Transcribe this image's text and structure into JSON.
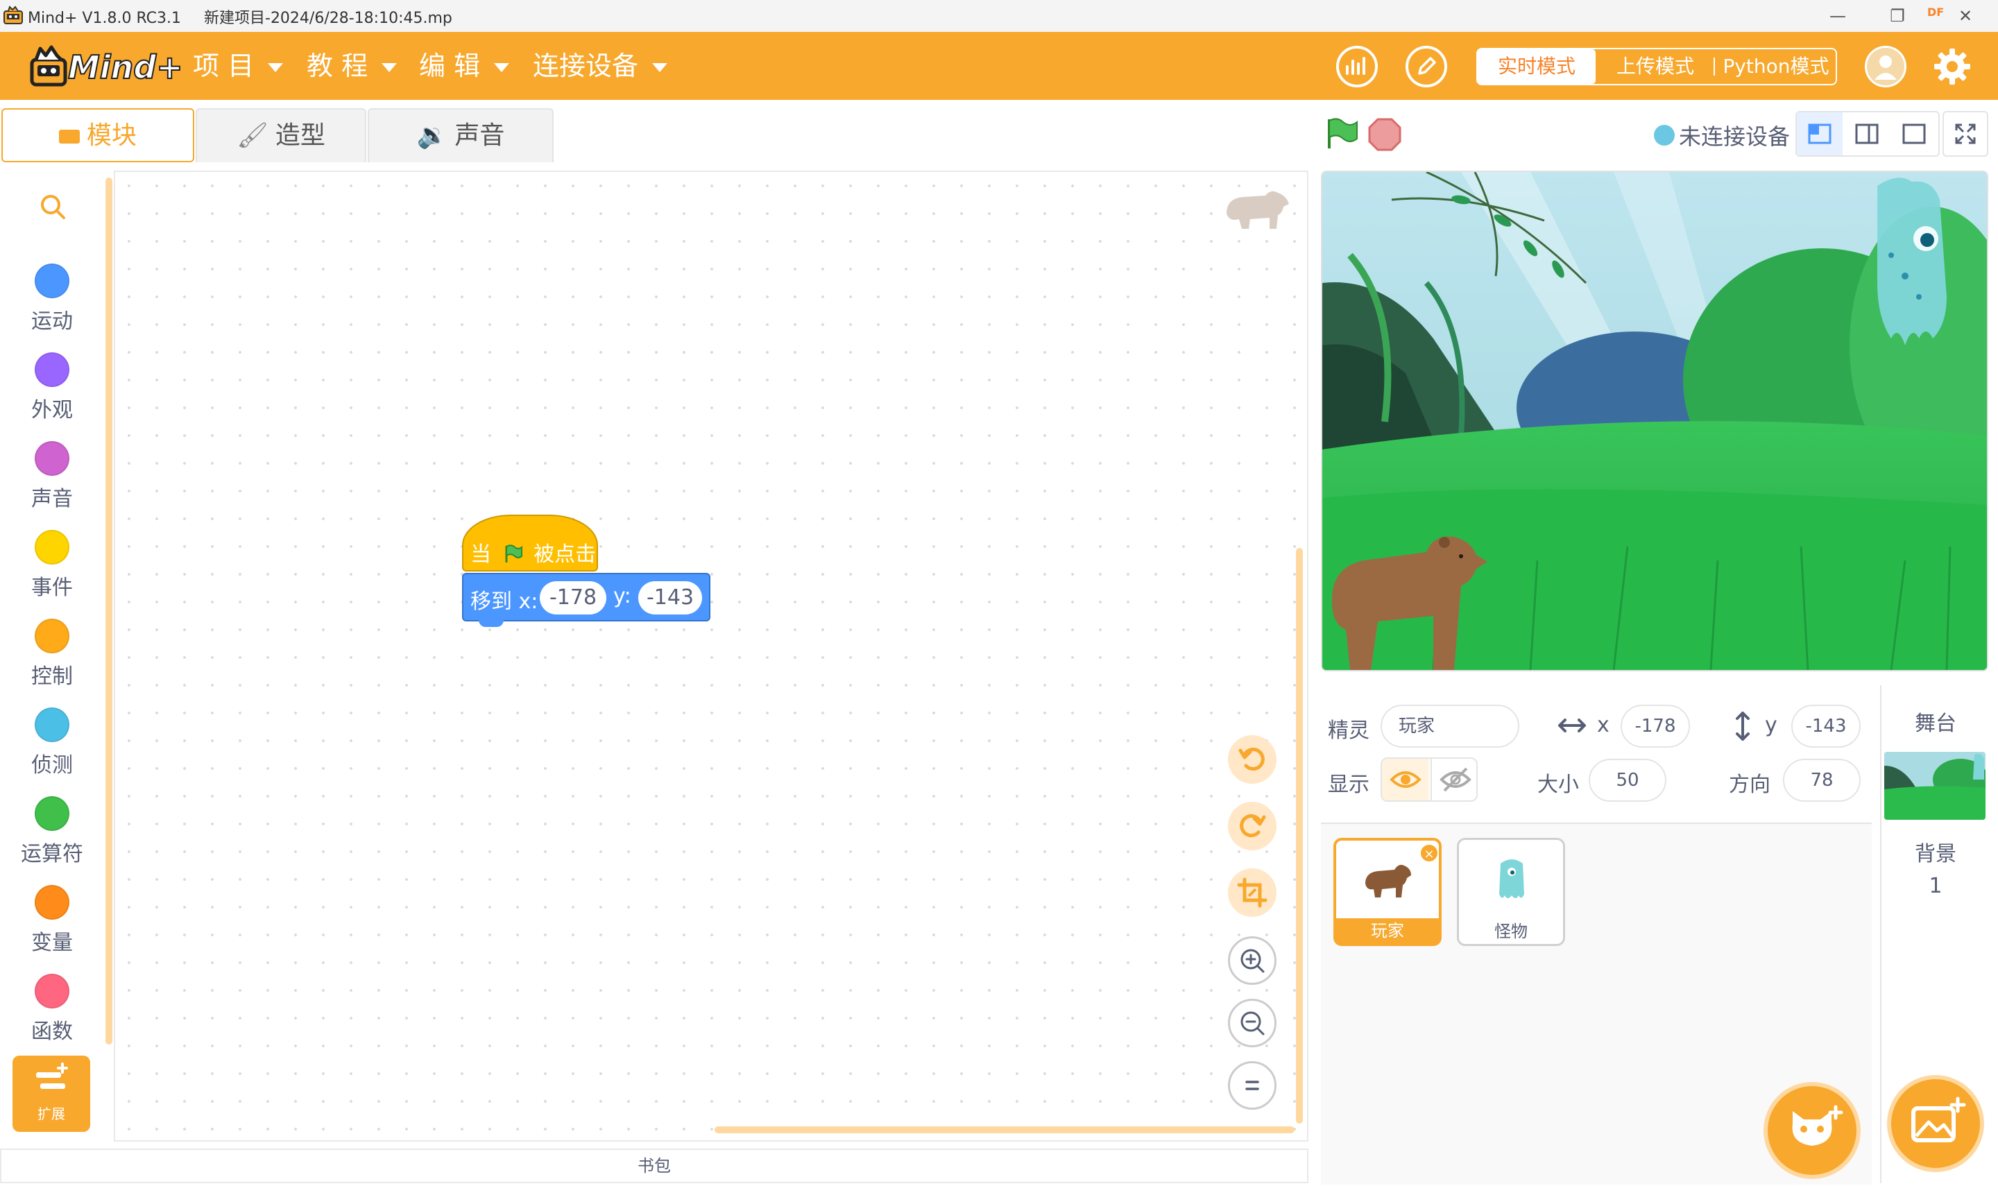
{
  "window": {
    "app_title": "Mind+ V1.8.0 RC3.1",
    "file_title": "新建项目-2024/6/28-18:10:45.mp",
    "df_badge": "DF",
    "icons": [
      "minimize-icon",
      "restore-icon",
      "close-icon"
    ]
  },
  "menubar": {
    "logo_text": "Mind+",
    "menus": [
      "项 目",
      "教 程",
      "编 辑",
      "连接设备"
    ],
    "modes": [
      "实时模式",
      "上传模式",
      "Python模式"
    ],
    "active_mode": "实时模式"
  },
  "tabs": [
    {
      "label": "模块",
      "icon": "blocks-icon",
      "active": true
    },
    {
      "label": "造型",
      "icon": "brush-icon",
      "active": false
    },
    {
      "label": "声音",
      "icon": "speaker-icon",
      "active": false
    }
  ],
  "categories": [
    {
      "label": "运动",
      "color": "#4c97ff"
    },
    {
      "label": "外观",
      "color": "#9966ff"
    },
    {
      "label": "声音",
      "color": "#cf63cf"
    },
    {
      "label": "事件",
      "color": "#ffd500"
    },
    {
      "label": "控制",
      "color": "#ffab19"
    },
    {
      "label": "侦测",
      "color": "#4cbfe6"
    },
    {
      "label": "运算符",
      "color": "#40bf4a"
    },
    {
      "label": "变量",
      "color": "#ff8c1a"
    },
    {
      "label": "函数",
      "color": "#ff6680"
    }
  ],
  "extension": {
    "label": "扩展"
  },
  "script": {
    "hat": {
      "prefix": "当",
      "suffix": "被点击"
    },
    "motion": {
      "label": "移到 x:",
      "x": "-178",
      "y_label": "y:",
      "y": "-143"
    }
  },
  "backpack": {
    "label": "书包"
  },
  "stage_header": {
    "device_status": "未连接设备"
  },
  "sprite_info": {
    "sprite_label": "精灵",
    "sprite_name": "玩家",
    "x_label": "x",
    "x": "-178",
    "y_label": "y",
    "y": "-143",
    "show_label": "显示",
    "size_label": "大小",
    "size": "50",
    "direction_label": "方向",
    "direction": "78"
  },
  "sprites": [
    {
      "name": "玩家",
      "selected": true
    },
    {
      "name": "怪物",
      "selected": false
    }
  ],
  "stage_panel": {
    "title": "舞台",
    "backdrop_label": "背景",
    "backdrop_count": "1"
  },
  "colors": {
    "brand": "#f7a82d",
    "motion": "#4c97ff",
    "events": "#ffbf00",
    "accent_text": "#f7832a"
  }
}
